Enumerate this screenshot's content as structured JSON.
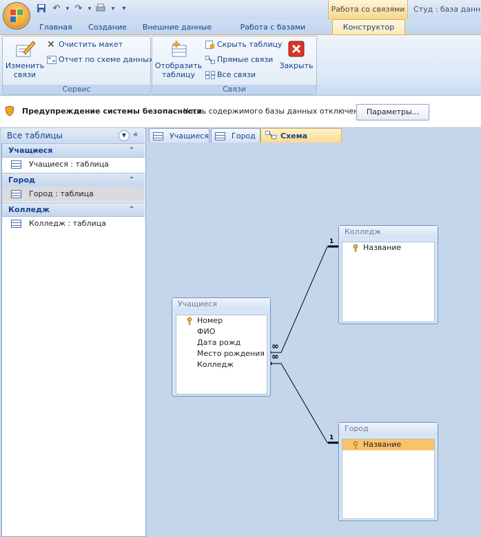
{
  "window": {
    "context_group": "Работа со связями",
    "app_title": "Студ : база данных"
  },
  "tabs": [
    {
      "label": "Главная"
    },
    {
      "label": "Создание"
    },
    {
      "label": "Внешние данные"
    },
    {
      "label": "Работа с базами данных"
    },
    {
      "label": "Конструктор"
    }
  ],
  "ribbon": {
    "service": {
      "label": "Сервис",
      "edit_links": "Изменить\nсвязи",
      "clear_layout": "Очистить макет",
      "schema_report": "Отчет по схеме данных"
    },
    "links": {
      "label": "Связи",
      "show_table": "Отобразить\nтаблицу",
      "hide_table": "Скрыть таблицу",
      "direct_links": "Прямые связи",
      "all_links": "Все связи",
      "close": "Закрыть"
    }
  },
  "security": {
    "title": "Предупреждение системы безопасности",
    "message": "Часть содержимого базы данных отключено",
    "button": "Параметры..."
  },
  "nav": {
    "header": "Все таблицы",
    "groups": [
      {
        "name": "Учащиеся",
        "item": "Учащиеся : таблица"
      },
      {
        "name": "Город",
        "item": "Город : таблица"
      },
      {
        "name": "Колледж",
        "item": "Колледж : таблица"
      }
    ]
  },
  "doc_tabs": [
    {
      "label": "Учащиеся"
    },
    {
      "label": "Город"
    },
    {
      "label": "Схема данных"
    }
  ],
  "schema": {
    "students": {
      "title": "Учащиеся",
      "fields": [
        "Номер",
        "ФИО",
        "Дата рожд",
        "Место рождения",
        "Колледж"
      ]
    },
    "college": {
      "title": "Колледж",
      "fields": [
        "Название"
      ]
    },
    "city": {
      "title": "Город",
      "fields": [
        "Название"
      ]
    },
    "relation_one": "1",
    "relation_many": "∞"
  },
  "colors": {
    "accent": "#15428b",
    "selected_field": "#f9c36b",
    "context_tab": "#fde9b5"
  }
}
